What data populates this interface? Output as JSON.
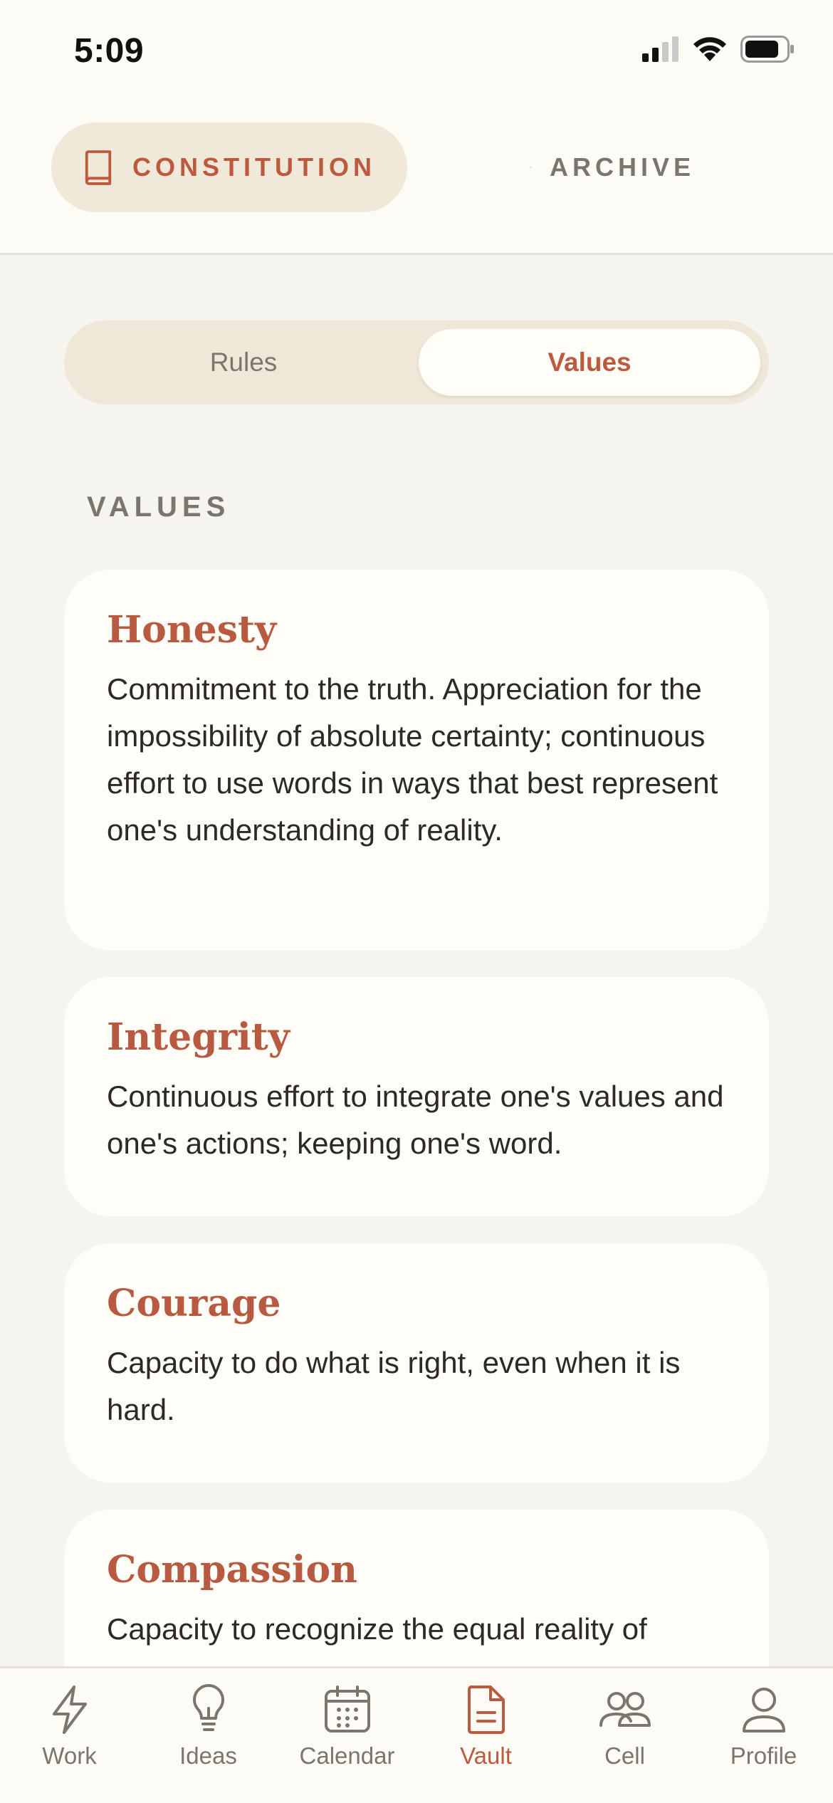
{
  "status_bar": {
    "time": "5:09"
  },
  "header": {
    "constitution_label": "CONSTITUTION",
    "archive_label": "ARCHIVE"
  },
  "segmented": {
    "left_label": "Rules",
    "right_label": "Values",
    "selected": "Values"
  },
  "section": {
    "title": "VALUES"
  },
  "values": [
    {
      "title": "Honesty",
      "body": "Commitment to the truth. Appreciation for the impossibility of absolute certainty; continuous effort to use words in ways that best represent one's understanding of reality."
    },
    {
      "title": "Integrity",
      "body": "Continuous effort to integrate one's values and one's actions; keeping one's word."
    },
    {
      "title": "Courage",
      "body": "Capacity to do what is right, even when it is hard."
    },
    {
      "title": "Compassion",
      "body": "Capacity to recognize the equal reality of"
    }
  ],
  "tabs": [
    {
      "label": "Work",
      "icon": "bolt-icon"
    },
    {
      "label": "Ideas",
      "icon": "lightbulb-icon"
    },
    {
      "label": "Calendar",
      "icon": "calendar-icon"
    },
    {
      "label": "Vault",
      "icon": "document-icon"
    },
    {
      "label": "Cell",
      "icon": "people-icon"
    },
    {
      "label": "Profile",
      "icon": "person-icon"
    }
  ],
  "active_tab": "Vault",
  "colors": {
    "accent": "#bd5a3e",
    "muted": "#7a756d",
    "card": "#fffdf8",
    "pill": "#f0e9da"
  }
}
